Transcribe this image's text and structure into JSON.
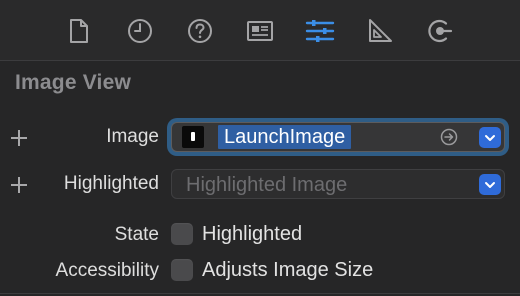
{
  "toolbar": {
    "icons": [
      "file-icon",
      "history-icon",
      "help-icon",
      "identity-icon",
      "attributes-icon",
      "size-icon",
      "connections-icon"
    ],
    "active": "attributes-icon",
    "active_color": "#3b8ee6",
    "icon_color": "#a4a4a6"
  },
  "section": {
    "title": "Image View"
  },
  "image_row": {
    "label": "Image",
    "value": "LaunchImage"
  },
  "highlighted_row": {
    "label": "Highlighted",
    "placeholder": "Highlighted Image"
  },
  "state_row": {
    "label": "State",
    "checkbox_label": "Highlighted",
    "checked": false
  },
  "accessibility_row": {
    "label": "Accessibility",
    "checkbox_label": "Adjusts Image Size",
    "checked": false
  }
}
